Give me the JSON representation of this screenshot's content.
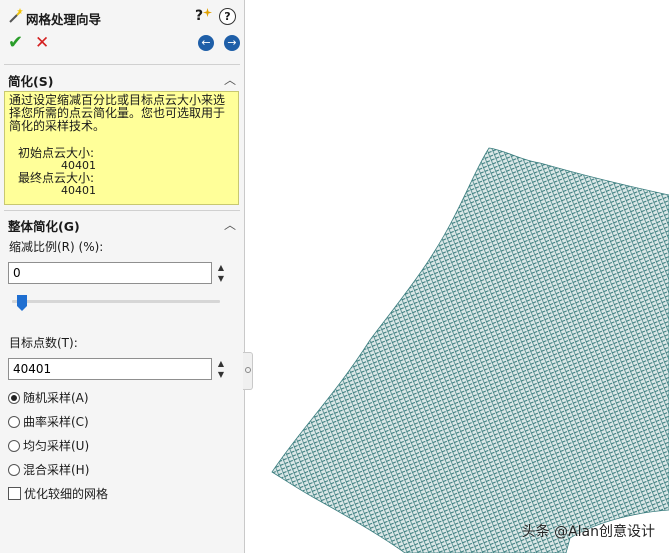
{
  "panel": {
    "title": "网格处理向导",
    "help_glyph": "?",
    "ok_glyph": "✔",
    "cancel_glyph": "✕",
    "back_glyph": "←",
    "next_glyph": "→"
  },
  "simplify": {
    "heading": "简化(S)",
    "description": "通过设定缩减百分比或目标点云大小来选择您所需的点云简化量。您也可选取用于简化的采样技术。",
    "initial_label": "初始点云大小:",
    "initial_value": "40401",
    "final_label": "最终点云大小:",
    "final_value": "40401"
  },
  "overall": {
    "heading": "整体简化(G)",
    "reduction_label": "缩减比例(R) (%):",
    "reduction_value": "0",
    "slider_fraction": 0,
    "target_label": "目标点数(T):",
    "target_value": "40401",
    "options": [
      {
        "label": "随机采样(A)",
        "selected": true
      },
      {
        "label": "曲率采样(C)",
        "selected": false
      },
      {
        "label": "均匀采样(U)",
        "selected": false
      },
      {
        "label": "混合采样(H)",
        "selected": false
      }
    ],
    "refine_label": "优化较细的网格",
    "refine_checked": false
  },
  "viewport": {
    "mesh_color": "#3d7f80"
  },
  "watermark": "头条 @Alan创意设计",
  "icons": {
    "wizard": "magic-wand-icon",
    "help": "help-icon",
    "ok": "checkmark-icon",
    "cancel": "close-icon",
    "back": "arrow-left-icon",
    "next": "arrow-right-icon",
    "collapse": "chevron-up-icon",
    "slider": "slider-thumb-icon"
  }
}
